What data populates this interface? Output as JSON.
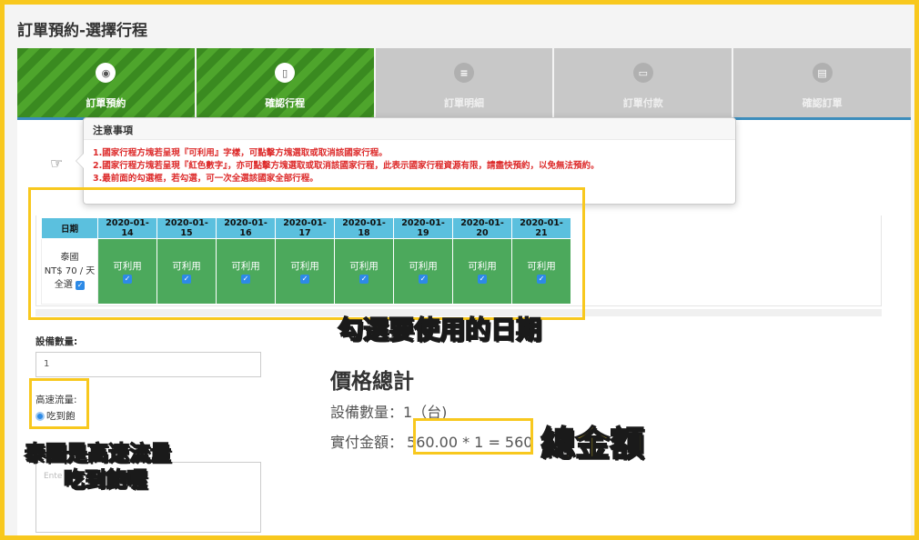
{
  "page_title": "訂單預約-選擇行程",
  "steps": [
    {
      "label": "訂單預約",
      "icon": "globe-icon",
      "state": "active"
    },
    {
      "label": "確認行程",
      "icon": "phone-icon",
      "state": "active"
    },
    {
      "label": "訂單明細",
      "icon": "list-icon",
      "state": "inactive"
    },
    {
      "label": "訂單付款",
      "icon": "credit-card-icon",
      "state": "inactive"
    },
    {
      "label": "確認訂單",
      "icon": "document-icon",
      "state": "inactive"
    }
  ],
  "notice": {
    "title": "注意事項",
    "lines": [
      "1.國家行程方塊若呈現『可利用』字樣，可點擊方塊選取或取消該國家行程。",
      "2.國家行程方塊若呈現『紅色數字』，亦可點擊方塊選取或取消該國家行程，此表示國家行程資源有限，請盡快預約，以免無法預約。",
      "3.最前面的勾選框，若勾選，可一次全選該國家全部行程。"
    ]
  },
  "date_table": {
    "header_label": "日期",
    "dates": [
      "2020-01-14",
      "2020-01-15",
      "2020-01-16",
      "2020-01-17",
      "2020-01-18",
      "2020-01-19",
      "2020-01-20",
      "2020-01-21"
    ],
    "country": "泰國",
    "price": "NT$ 70 / 天",
    "select_all": "全選",
    "cell_label": "可利用"
  },
  "form": {
    "qty_label": "設備數量:",
    "qty_value": "1",
    "speed_label": "高速流量:",
    "speed_option": "吃到飽",
    "note_placeholder": "Ente"
  },
  "price_summary": {
    "title": "價格總計",
    "qty_line": "設備數量：1（台)",
    "total_label": "實付金額：",
    "total_value": "560.00 * 1 = 560"
  },
  "annotations": {
    "select_dates": "勾選要使用的日期",
    "total_amount": "總金額",
    "thailand_line1": "泰國是高速流量",
    "thailand_line2": "吃到飽喔"
  },
  "colors": {
    "highlight": "#f8c81e",
    "active_step": "#3a8a20",
    "available": "#4ca95c",
    "header": "#5bc0de"
  }
}
